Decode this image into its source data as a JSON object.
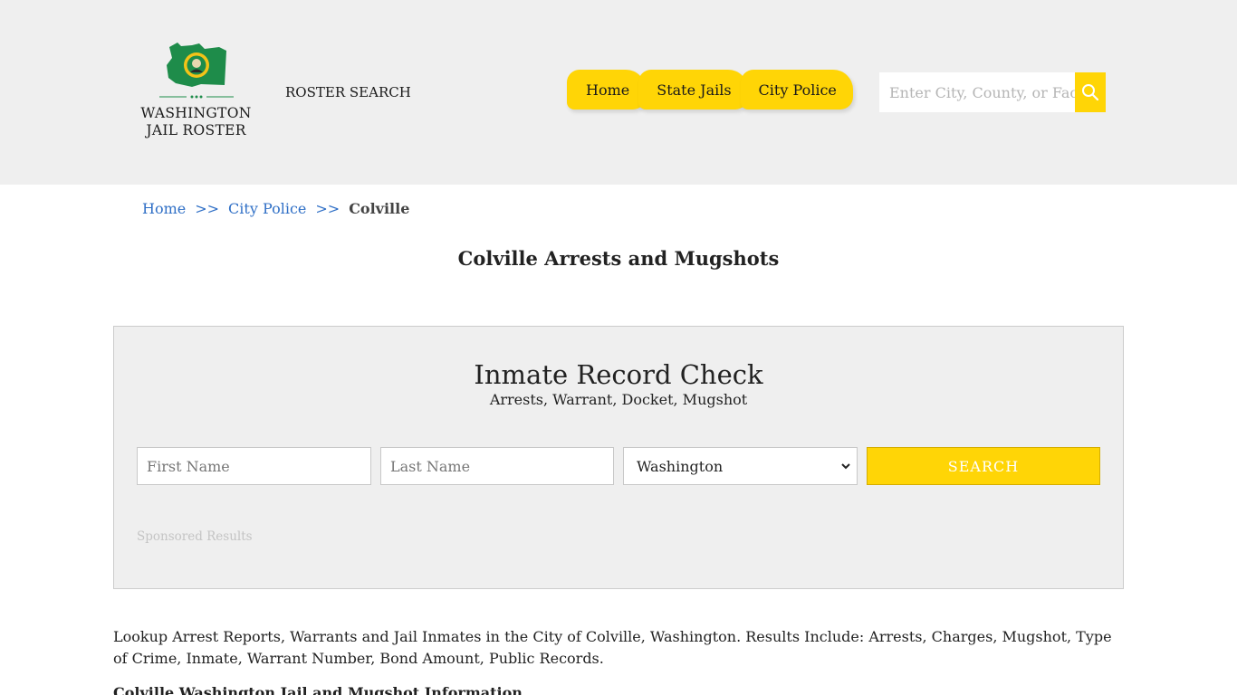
{
  "header": {
    "logo_line1": "WASHINGTON",
    "logo_line2": "JAIL ROSTER",
    "roster_link": "ROSTER SEARCH",
    "nav": [
      {
        "label": "Home"
      },
      {
        "label": "State Jails"
      },
      {
        "label": "City Police"
      }
    ],
    "search_placeholder": "Enter City, County, or Facility"
  },
  "breadcrumb": {
    "home": "Home",
    "sep": ">>",
    "section": "City Police",
    "current": "Colville"
  },
  "page_title": "Colville Arrests and Mugshots",
  "record_check": {
    "title": "Inmate Record Check",
    "subtitle": "Arrests, Warrant, Docket, Mugshot",
    "first_name_placeholder": "First Name",
    "last_name_placeholder": "Last Name",
    "state_selected": "Washington",
    "search_button": "SEARCH",
    "sponsored": "Sponsored Results"
  },
  "description": "Lookup Arrest Reports, Warrants and Jail Inmates in the City of Colville, Washington. Results Include: Arrests, Charges, Mugshot, Type of Crime, Inmate, Warrant Number, Bond Amount, Public Records.",
  "subheading": "Colville Washington Jail and Mugshot Information",
  "colors": {
    "accent": "#ffd506",
    "header_bg": "#efefef",
    "link": "#2f6fc6",
    "flag_green": "#1e8c4a"
  }
}
